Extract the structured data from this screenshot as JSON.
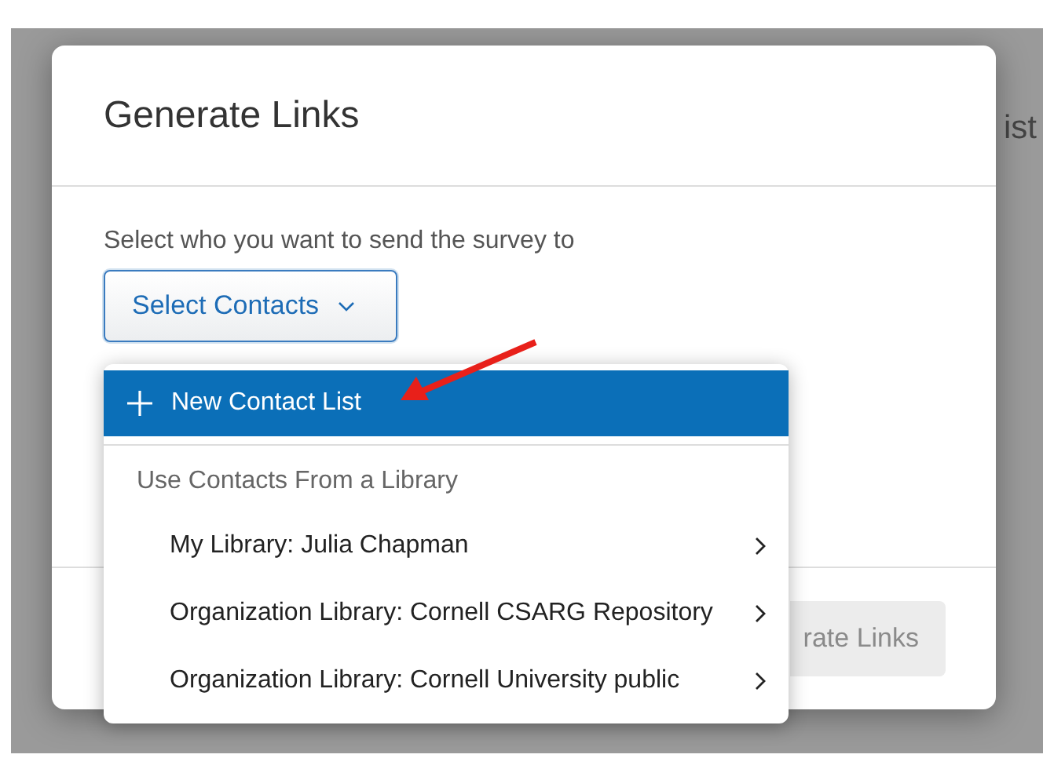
{
  "background": {
    "text_fragment": "ist"
  },
  "modal": {
    "title": "Generate Links",
    "prompt": "Select who you want to send the survey to",
    "select_button": {
      "label": "Select Contacts",
      "expanded": true
    },
    "footer_button": {
      "label": "rate Links",
      "disabled": true
    }
  },
  "dropdown": {
    "items": [
      {
        "kind": "action",
        "label": "New Contact List",
        "selected": true
      },
      {
        "kind": "header",
        "label": "Use Contacts From a Library"
      },
      {
        "kind": "submenu",
        "label": "My Library: Julia Chapman",
        "selected": false
      },
      {
        "kind": "submenu",
        "label": "Organization Library: Cornell CSARG Repository",
        "selected": false
      },
      {
        "kind": "submenu",
        "label": "Organization Library: Cornell University public",
        "selected": false
      }
    ]
  }
}
